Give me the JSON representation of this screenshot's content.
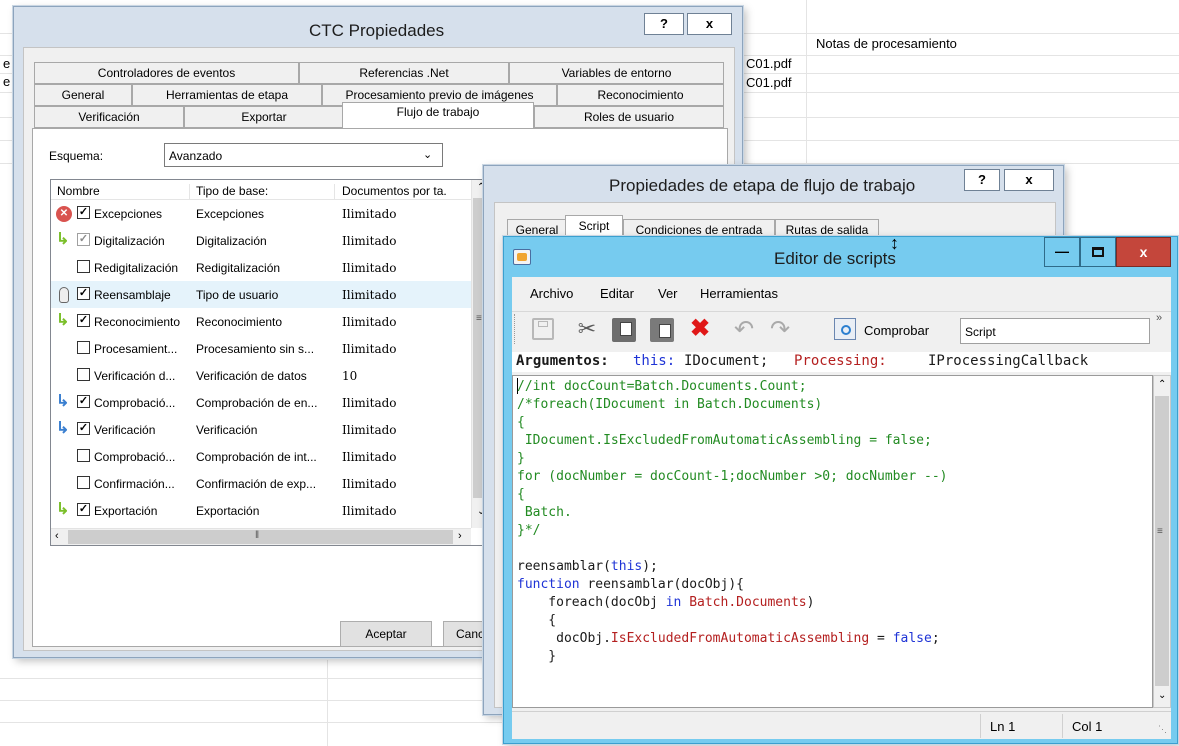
{
  "background": {
    "column_header": "Notas de procesamiento",
    "file_cells": [
      "C01.pdf",
      "C01.pdf"
    ],
    "left_letters": [
      "e",
      "e"
    ]
  },
  "ctc": {
    "title": "CTC Propiedades",
    "help_label": "?",
    "close_label": "x",
    "tabs_row1": [
      "Controladores de eventos",
      "Referencias .Net",
      "Variables de entorno"
    ],
    "tabs_row2": [
      "General",
      "Herramientas de etapa",
      "Procesamiento previo de imágenes",
      "Reconocimiento"
    ],
    "tabs_row3": [
      "Verificación",
      "Exportar",
      "Flujo de trabajo",
      "Roles de usuario"
    ],
    "schema_label": "Esquema:",
    "schema_value": "Avanzado",
    "columns": [
      "Nombre",
      "Tipo de base:",
      "Documentos por ta."
    ],
    "rows": [
      {
        "icon": "error-icon",
        "checked": true,
        "dim": false,
        "name": "Excepciones",
        "type": "Excepciones",
        "docs": "Ilimitado"
      },
      {
        "icon": "arrow-icon",
        "checked": true,
        "dim": true,
        "name": "Digitalización",
        "type": "Digitalización",
        "docs": "Ilimitado"
      },
      {
        "icon": "",
        "checked": false,
        "dim": false,
        "name": "Redigitalización",
        "type": "Redigitalización",
        "docs": "Ilimitado"
      },
      {
        "icon": "user-icon",
        "checked": true,
        "dim": false,
        "name": "Reensamblaje",
        "type": "Tipo de usuario",
        "docs": "Ilimitado"
      },
      {
        "icon": "arrow-icon",
        "checked": true,
        "dim": false,
        "name": "Reconocimiento",
        "type": "Reconocimiento",
        "docs": "Ilimitado"
      },
      {
        "icon": "",
        "checked": false,
        "dim": false,
        "name": "Procesamient...",
        "type": "Procesamiento sin s...",
        "docs": "Ilimitado"
      },
      {
        "icon": "",
        "checked": false,
        "dim": false,
        "name": "Verificación d...",
        "type": "Verificación de datos",
        "docs": "10"
      },
      {
        "icon": "arrow-blue-icon",
        "checked": true,
        "dim": false,
        "name": "Comprobació...",
        "type": "Comprobación de en...",
        "docs": "Ilimitado"
      },
      {
        "icon": "arrow-blue-icon",
        "checked": true,
        "dim": false,
        "name": "Verificación",
        "type": "Verificación",
        "docs": "Ilimitado"
      },
      {
        "icon": "",
        "checked": false,
        "dim": false,
        "name": "Comprobació...",
        "type": "Comprobación de int...",
        "docs": "Ilimitado"
      },
      {
        "icon": "",
        "checked": false,
        "dim": false,
        "name": "Confirmación...",
        "type": "Confirmación de exp...",
        "docs": "Ilimitado"
      },
      {
        "icon": "arrow-icon",
        "checked": true,
        "dim": false,
        "name": "Exportación",
        "type": "Exportación",
        "docs": "Ilimitado"
      }
    ],
    "accept_label": "Aceptar",
    "cancel_label": "Cance"
  },
  "stage": {
    "title": "Propiedades de etapa de flujo de trabajo",
    "help_label": "?",
    "close_label": "x",
    "tabs": [
      "General",
      "Script",
      "Condiciones de entrada",
      "Rutas de salida"
    ]
  },
  "editor": {
    "title": "Editor de scripts",
    "menu": [
      "Archivo",
      "Editar",
      "Ver",
      "Herramientas"
    ],
    "check_label": "Comprobar",
    "script_field": "Script",
    "args": {
      "label": "Argumentos:",
      "this_kw": "this:",
      "this_type": "IDocument;",
      "proc_kw": "Processing:",
      "proc_type": "IProcessingCallback"
    },
    "code": [
      [
        {
          "t": "//int docCount=Batch.Documents.Count;",
          "c": "green"
        }
      ],
      [
        {
          "t": "/*foreach(IDocument in Batch.Documents)",
          "c": "green"
        }
      ],
      [
        {
          "t": "{",
          "c": "green"
        }
      ],
      [
        {
          "t": " IDocument.IsExcludedFromAutomaticAssembling = false;",
          "c": "green"
        }
      ],
      [
        {
          "t": "}",
          "c": "green"
        }
      ],
      [
        {
          "t": "for (docNumber = docCount-1;docNumber >0; docNumber --)",
          "c": "green"
        }
      ],
      [
        {
          "t": "{",
          "c": "green"
        }
      ],
      [
        {
          "t": " Batch.",
          "c": "green"
        }
      ],
      [
        {
          "t": "}*/",
          "c": "green"
        }
      ],
      [
        {
          "t": "",
          "c": "black"
        }
      ],
      [
        {
          "t": "reensamblar(",
          "c": "black"
        },
        {
          "t": "this",
          "c": "blue"
        },
        {
          "t": ");",
          "c": "black"
        }
      ],
      [
        {
          "t": "function",
          "c": "blue"
        },
        {
          "t": " reensamblar(docObj){",
          "c": "black"
        }
      ],
      [
        {
          "t": "    foreach(docObj ",
          "c": "black"
        },
        {
          "t": "in",
          "c": "blue"
        },
        {
          "t": " ",
          "c": "black"
        },
        {
          "t": "Batch.Documents",
          "c": "red"
        },
        {
          "t": ")",
          "c": "black"
        }
      ],
      [
        {
          "t": "    {",
          "c": "black"
        }
      ],
      [
        {
          "t": "     docObj.",
          "c": "black"
        },
        {
          "t": "IsExcludedFromAutomaticAssembling",
          "c": "red"
        },
        {
          "t": " = ",
          "c": "black"
        },
        {
          "t": "false",
          "c": "blue"
        },
        {
          "t": ";",
          "c": "black"
        }
      ],
      [
        {
          "t": "    }",
          "c": "black"
        }
      ]
    ],
    "status_ln": "Ln 1",
    "status_col": "Col 1",
    "colors": {
      "titlebar": "#76cbef",
      "close": "#c4463b"
    }
  }
}
